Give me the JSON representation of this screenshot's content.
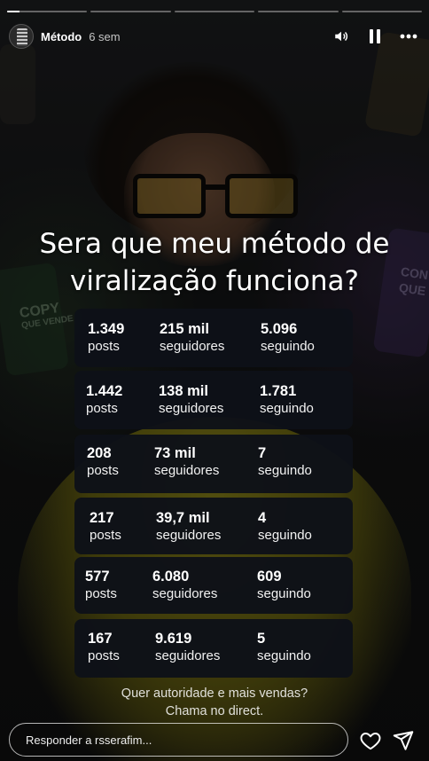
{
  "story": {
    "progress_segments": [
      1.0,
      0.0,
      0.0,
      0.0,
      0.0
    ],
    "progress_active_fill": 0.15,
    "account_name": "Método",
    "time_ago": "6 sem",
    "headline_line1": "Sera que meu método de",
    "headline_line2": "viralização funciona?",
    "stats": [
      {
        "posts": "1.349",
        "posts_label": "posts",
        "followers": "215 mil",
        "followers_label": "seguidores",
        "following": "5.096",
        "following_label": "seguindo"
      },
      {
        "posts": "1.442",
        "posts_label": "posts",
        "followers": "138 mil",
        "followers_label": "seguidores",
        "following": "1.781",
        "following_label": "seguindo"
      },
      {
        "posts": "208",
        "posts_label": "posts",
        "followers": "73 mil",
        "followers_label": "seguidores",
        "following": "7",
        "following_label": "seguindo"
      },
      {
        "posts": "217",
        "posts_label": "posts",
        "followers": "39,7 mil",
        "followers_label": "seguidores",
        "following": "4",
        "following_label": "seguindo"
      },
      {
        "posts": "577",
        "posts_label": "posts",
        "followers": "6.080",
        "followers_label": "seguidores",
        "following": "609",
        "following_label": "seguindo"
      },
      {
        "posts": "167",
        "posts_label": "posts",
        "followers": "9.619",
        "followers_label": "seguidores",
        "following": "5",
        "following_label": "seguindo"
      }
    ],
    "cta_line1": "Quer autoridade e mais vendas?",
    "cta_line2": "Chama no direct.",
    "background_text": {
      "left_1": "COPY",
      "left_2": "QUE VENDE",
      "right_1": "CON",
      "right_2": "QUE"
    }
  },
  "footer": {
    "reply_placeholder": "Responder a rsserafim..."
  },
  "icons": [
    "volume-icon",
    "pause-icon",
    "more-icon",
    "heart-icon",
    "send-icon"
  ]
}
